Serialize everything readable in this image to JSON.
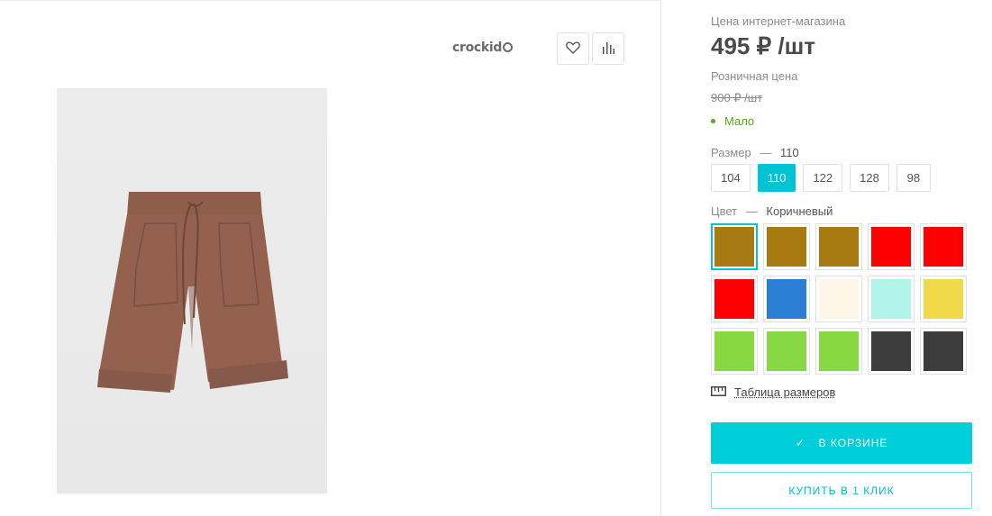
{
  "brand": {
    "name": "crockid"
  },
  "gallery": {
    "favorite_icon": "heart-icon",
    "compare_icon": "bar-chart-icon",
    "product_image": "brown-shorts-photo"
  },
  "pricing": {
    "online_label": "Цена интернет-магазина",
    "online_price": "495 ₽ /шт",
    "retail_label": "Розничная цена",
    "retail_price": "900 ₽ /шт"
  },
  "stock": {
    "label": "Мало",
    "color": "#5aa61c"
  },
  "size": {
    "label": "Размер",
    "dash": "—",
    "selected": "110",
    "options": [
      "104",
      "110",
      "122",
      "128",
      "98"
    ],
    "active_index": 1
  },
  "color": {
    "label": "Цвет",
    "dash": "—",
    "selected": "Коричневый",
    "swatches": [
      "#a87b12",
      "#a87b12",
      "#a87b12",
      "#ff0000",
      "#ff0000",
      "#ff0000",
      "#2a7fd4",
      "#fdf6e6",
      "#aff3e9",
      "#f0da4a",
      "#88d843",
      "#88d843",
      "#88d843",
      "#3c3c3c",
      "#3c3c3c"
    ],
    "selected_index": 0
  },
  "size_table": {
    "label": "Таблица размеров",
    "icon": "ruler-icon"
  },
  "actions": {
    "cart_label": "В КОРЗИНЕ",
    "cart_icon": "check-icon",
    "buy_label": "КУПИТЬ В 1 КЛИК"
  },
  "colors": {
    "accent": "#00ced9",
    "price_text": "#4a4a4a"
  }
}
